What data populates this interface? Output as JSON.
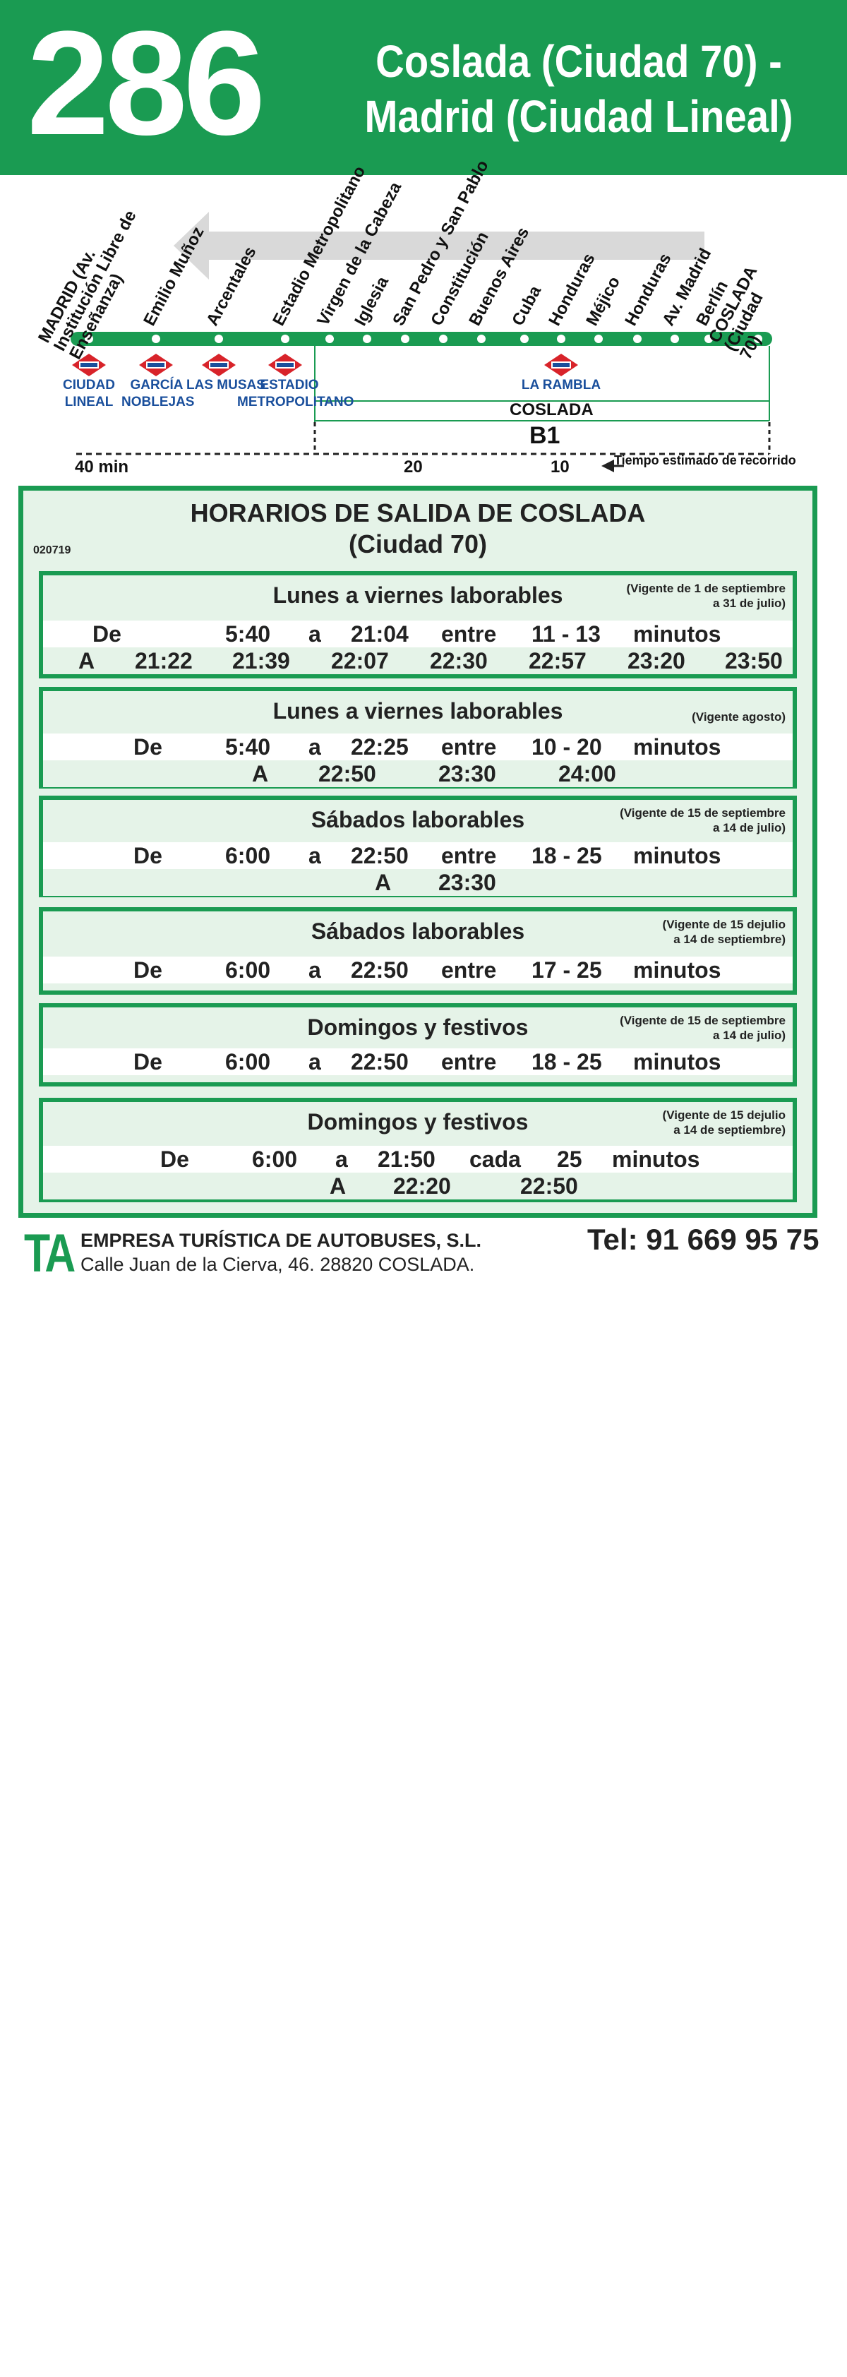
{
  "header": {
    "route_number": "286",
    "route_name_line1": "Coslada (Ciudad 70) -",
    "route_name_line2": "Madrid (Ciudad Lineal)"
  },
  "stops": [
    "MADRID (Av. Institución Libre de Enseñanza)",
    "Emilio Muñoz",
    "Arcentales",
    "Estadio Metropolitano",
    "Virgen de la Cabeza",
    "Iglesia",
    "San Pedro y San Pablo",
    "Constitución",
    "Buenos Aires",
    "Cuba",
    "Honduras",
    "Méjico",
    "Honduras",
    "Av. Madrid",
    "Berlín",
    "COSLADA (Ciudad 70)"
  ],
  "metro_stations": {
    "ciudad_lineal_1": "CIUDAD",
    "ciudad_lineal_2": "LINEAL",
    "garcia_noblejas_1": "GARCÍA",
    "garcia_noblejas_2": "NOBLEJAS",
    "las_musas": "LAS MUSAS",
    "estadio_1": "ESTADIO",
    "estadio_2": "METROPOLITANO",
    "la_rambla": "LA RAMBLA"
  },
  "zone": {
    "coslada": "COSLADA",
    "fare_zone": "B1"
  },
  "travel_time": {
    "t40": "40 min",
    "t20": "20",
    "t10": "10",
    "legend": "Tiempo estimado de recorrido"
  },
  "schedule": {
    "title_line1": "HORARIOS DE SALIDA DE COSLADA",
    "title_line2": "(Ciudad 70)",
    "code": "020719",
    "blocks": [
      {
        "title": "Lunes a viernes laborables",
        "note_line1": "(Vigente de 1 de septiembre",
        "note_line2": "a 31 de julio)",
        "row1": [
          "De",
          "5:40",
          "a",
          "21:04",
          "entre",
          "11 - 13",
          "minutos"
        ],
        "row2": [
          "A",
          "21:22",
          "21:39",
          "22:07",
          "22:30",
          "22:57",
          "23:20",
          "23:50"
        ]
      },
      {
        "title": "Lunes a viernes laborables",
        "note_line1": "(Vigente agosto)",
        "note_line2": "",
        "row1": [
          "De",
          "5:40",
          "a",
          "22:25",
          "entre",
          "10 - 20",
          "minutos"
        ],
        "row2": [
          "A",
          "22:50",
          "23:30",
          "24:00"
        ]
      },
      {
        "title": "Sábados laborables",
        "note_line1": "(Vigente de 15 de septiembre",
        "note_line2": "a 14 de julio)",
        "row1": [
          "De",
          "6:00",
          "a",
          "22:50",
          "entre",
          "18 - 25",
          "minutos"
        ],
        "row2": [
          "A",
          "23:30"
        ]
      },
      {
        "title": "Sábados laborables",
        "note_line1": "(Vigente de 15 dejulio",
        "note_line2": "a 14 de septiembre)",
        "row1": [
          "De",
          "6:00",
          "a",
          "22:50",
          "entre",
          "17 - 25",
          "minutos"
        ]
      },
      {
        "title": "Domingos y festivos",
        "note_line1": "(Vigente de 15 de septiembre",
        "note_line2": "a 14 de julio)",
        "row1": [
          "De",
          "6:00",
          "a",
          "22:50",
          "entre",
          "18 - 25",
          "minutos"
        ]
      },
      {
        "title": "Domingos y festivos",
        "note_line1": "(Vigente de 15 dejulio",
        "note_line2": "a 14 de septiembre)",
        "row1": [
          "De",
          "6:00",
          "a",
          "21:50",
          "cada",
          "25",
          "minutos"
        ],
        "row2": [
          "A",
          "22:20",
          "22:50"
        ]
      }
    ]
  },
  "footer": {
    "logo": "TA",
    "company": "EMPRESA TURÍSTICA DE AUTOBUSES, S.L.",
    "address": "Calle Juan de la Cierva, 46. 28820 COSLADA.",
    "phone": "Tel: 91 669 95 75"
  },
  "colors": {
    "brand_green": "#1a9b52",
    "metro_blue": "#1a4f9c",
    "metro_red": "#d8232a",
    "light_green": "#e5f3e8"
  }
}
